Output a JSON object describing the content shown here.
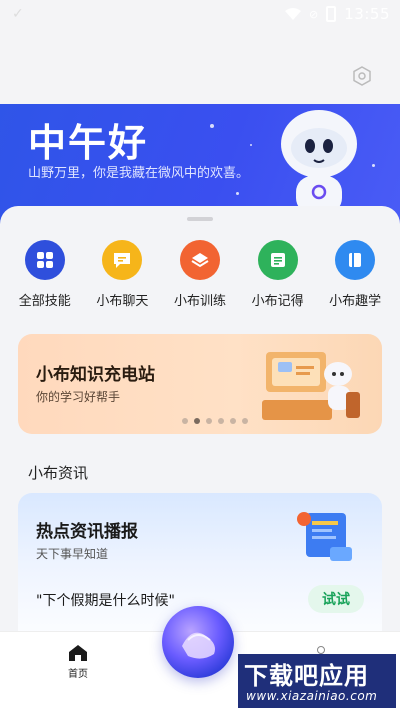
{
  "status_bar": {
    "time": "13:55"
  },
  "hero": {
    "greeting": "中午好",
    "subtitle": "山野万里，你是我藏在微风中的欢喜。"
  },
  "skills": [
    {
      "label": "全部技能",
      "color": "#2f4fdc",
      "icon": "grid-icon"
    },
    {
      "label": "小布聊天",
      "color": "#f6b51a",
      "icon": "chat-icon"
    },
    {
      "label": "小布训练",
      "color": "#f26432",
      "icon": "layers-icon"
    },
    {
      "label": "小布记得",
      "color": "#2eb25b",
      "icon": "notes-icon"
    },
    {
      "label": "小布趣学",
      "color": "#2f8af0",
      "icon": "book-icon"
    }
  ],
  "banner": {
    "title": "小布知识充电站",
    "subtitle": "你的学习好帮手",
    "active_slide": 2,
    "slide_count": 6
  },
  "news": {
    "section_title": "小布资讯",
    "card_title": "热点资讯播报",
    "card_subtitle": "天下事早知道",
    "question": "\"下个假期是什么时候\"",
    "try_label": "试试"
  },
  "tabbar": {
    "home_label": "首页"
  },
  "watermark": {
    "big": "下载吧应用",
    "small": "www.xiazainiao.com"
  }
}
